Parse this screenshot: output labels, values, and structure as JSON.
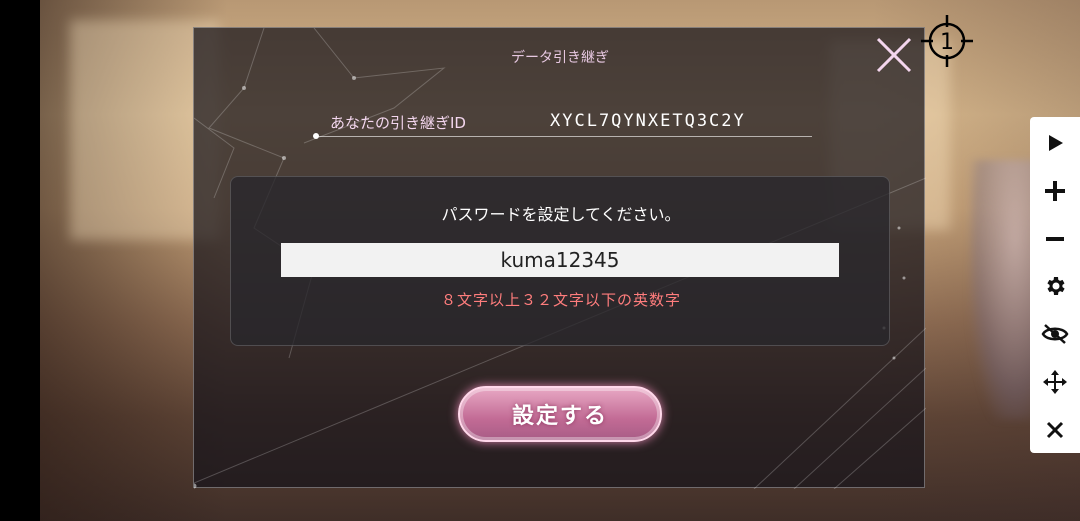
{
  "dialog": {
    "title": "データ引き継ぎ",
    "id_label": "あなたの引き継ぎID",
    "id_value": "XYCL7QYNXETQ3C2Y",
    "prompt": "パスワードを設定してください。",
    "password_value": "kuma12345",
    "hint": "８文字以上３２文字以下の英数字",
    "submit_label": "設定する"
  },
  "overlay": {
    "target_number": "1"
  },
  "toolbar": {
    "buttons": [
      "play-icon",
      "plus-icon",
      "minus-icon",
      "gear-icon",
      "eye-off-icon",
      "move-icon",
      "close-icon"
    ]
  },
  "colors": {
    "accent_pink": "#c26b95",
    "hint_red": "#ff7d7d",
    "title_pink": "#e6c7e0"
  }
}
